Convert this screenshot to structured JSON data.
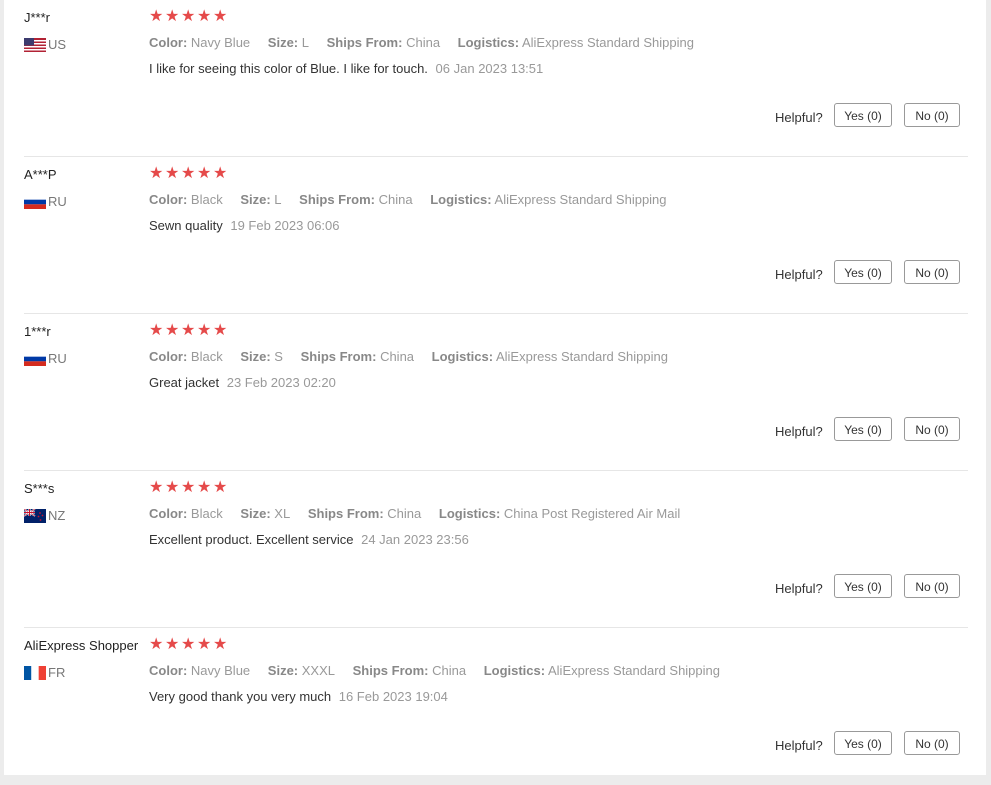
{
  "labels": {
    "color": "Color:",
    "size": "Size:",
    "ships_from": "Ships From:",
    "logistics": "Logistics:",
    "helpful": "Helpful?"
  },
  "colors": {
    "star": "#e54a4a",
    "divider": "#e6e6e6"
  },
  "reviews": [
    {
      "name": "J***r",
      "country": "US",
      "flag": "us-flag-icon",
      "stars": 5,
      "color": "Navy Blue",
      "size": "L",
      "ships_from": "China",
      "logistics": "AliExpress Standard Shipping",
      "comment": "I like for seeing this color of Blue. I like for touch.",
      "date": "06 Jan 2023 13:51",
      "yes": "Yes (0)",
      "no": "No (0)"
    },
    {
      "name": "A***P",
      "country": "RU",
      "flag": "ru-flag-icon",
      "stars": 5,
      "color": "Black",
      "size": "L",
      "ships_from": "China",
      "logistics": "AliExpress Standard Shipping",
      "comment": "Sewn quality",
      "date": "19 Feb 2023 06:06",
      "yes": "Yes (0)",
      "no": "No (0)"
    },
    {
      "name": "1***r",
      "country": "RU",
      "flag": "ru-flag-icon",
      "stars": 5,
      "color": "Black",
      "size": "S",
      "ships_from": "China",
      "logistics": "AliExpress Standard Shipping",
      "comment": "Great jacket",
      "date": "23 Feb 2023 02:20",
      "yes": "Yes (0)",
      "no": "No (0)"
    },
    {
      "name": "S***s",
      "country": "NZ",
      "flag": "nz-flag-icon",
      "stars": 5,
      "color": "Black",
      "size": "XL",
      "ships_from": "China",
      "logistics": "China Post Registered Air Mail",
      "comment": "Excellent product. Excellent service",
      "date": "24 Jan 2023 23:56",
      "yes": "Yes (0)",
      "no": "No (0)"
    },
    {
      "name": "AliExpress Shopper",
      "country": "FR",
      "flag": "fr-flag-icon",
      "stars": 5,
      "color": "Navy Blue",
      "size": "XXXL",
      "ships_from": "China",
      "logistics": "AliExpress Standard Shipping",
      "comment": "Very good thank you very much",
      "date": "16 Feb 2023 19:04",
      "yes": "Yes (0)",
      "no": "No (0)"
    }
  ]
}
